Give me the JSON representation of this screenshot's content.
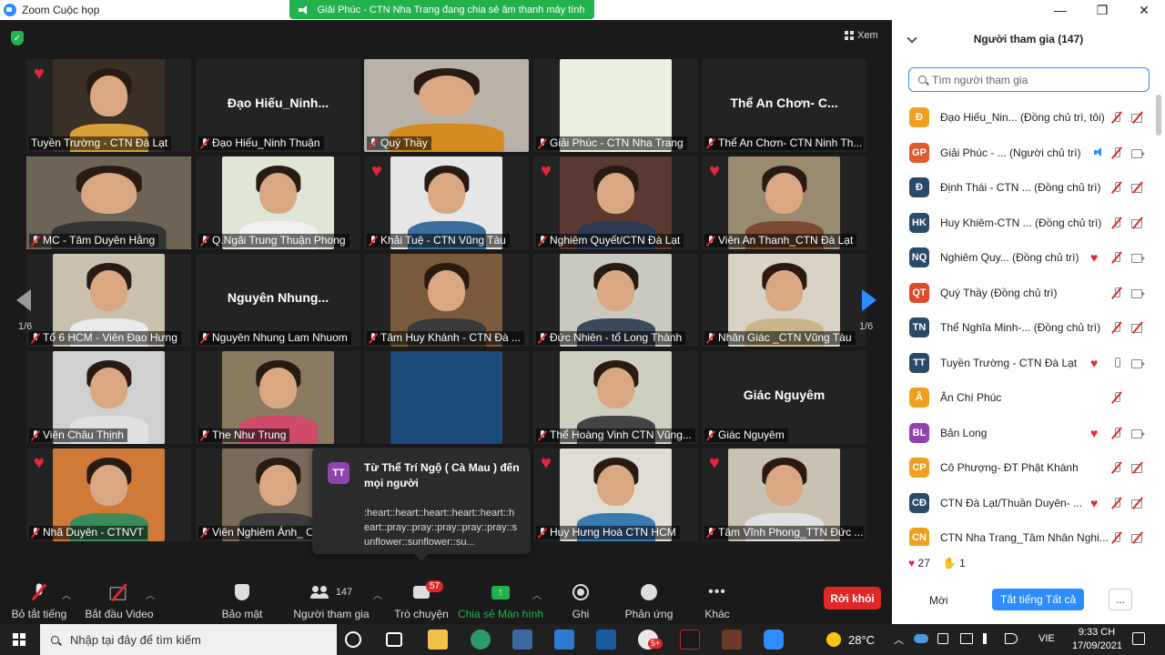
{
  "window": {
    "title": "Zoom Cuộc họp",
    "share_banner": "Giải Phúc - CTN Nha Trang đang chia sẻ âm thanh máy tính",
    "controls": [
      "—",
      "❐",
      "✕"
    ]
  },
  "meeting": {
    "view_label": "Xem",
    "page_left": "1/6",
    "page_right": "1/6",
    "tiles": [
      {
        "label": "Tuyền Trường - CTN Đà Lạt",
        "heart": true,
        "muted": false,
        "video": true,
        "bg": "#3b3025",
        "shirt": "#d9a03a"
      },
      {
        "label": "Đạo Hiếu_Ninh Thuận",
        "bigname": "Đạo  Hiếu_Ninh...",
        "heart": false,
        "muted": true,
        "video": false
      },
      {
        "label": "Quý Thầy",
        "heart": false,
        "muted": true,
        "video": true,
        "bg": "#b8b2a8",
        "shirt": "#d48a1e"
      },
      {
        "label": "Giải Phúc - CTN Nha Trang",
        "heart": false,
        "muted": true,
        "video": true,
        "bg": "#e9f2e2",
        "shirt": "#3f8f2f",
        "noface": true
      },
      {
        "label": "Thể An Chơn- CTN Ninh Th...",
        "bigname": "Thể An Chơn- C...",
        "heart": false,
        "muted": true,
        "video": false
      },
      {
        "label": "MC - Tâm Duyên Hằng",
        "heart": false,
        "muted": true,
        "video": true,
        "active": true,
        "bg": "#6e6455",
        "shirt": "#333"
      },
      {
        "label": "Q.Ngãi Trung Thuận Phong",
        "heart": false,
        "muted": true,
        "video": true,
        "bg": "#dfe6d6",
        "shirt": "#f0f0f0"
      },
      {
        "label": "Khải Tuệ - CTN Vũng Tàu",
        "heart": true,
        "muted": true,
        "video": true,
        "bg": "#e6e6e6",
        "shirt": "#3a6e9c"
      },
      {
        "label": "Nghiêm Quyết/CTN Đà Lạt",
        "heart": true,
        "muted": true,
        "video": true,
        "bg": "#5a3a30",
        "shirt": "#2c3a55"
      },
      {
        "label": "Viên An Thanh_CTN Đà Lạt",
        "heart": true,
        "muted": true,
        "video": true,
        "bg": "#9a8a70",
        "shirt": "#7a4a30"
      },
      {
        "label": "Tổ 6 HCM - Viên Đạo Hưng",
        "heart": false,
        "muted": true,
        "video": true,
        "bg": "#c9c0ad",
        "shirt": "#eaeaea"
      },
      {
        "label": "Nguyên Nhung Lam Nhuom",
        "bigname": "Nguyên  Nhung...",
        "heart": false,
        "muted": true,
        "video": false
      },
      {
        "label": "Tâm Huy Khánh - CTN Đà ...",
        "heart": false,
        "muted": true,
        "video": true,
        "bg": "#7a5a3a",
        "shirt": "#3a3a3a"
      },
      {
        "label": "Đức Nhiên - tổ Long Thành",
        "heart": false,
        "muted": true,
        "video": true,
        "bg": "#c9c9c2",
        "shirt": "#3a4a5a"
      },
      {
        "label": "Nhân Giác _CTN Vũng Tàu",
        "heart": false,
        "muted": true,
        "video": true,
        "bg": "#d9d2c5",
        "shirt": "#c9b58a"
      },
      {
        "label": "Viên Châu Thịnh",
        "heart": false,
        "muted": true,
        "video": true,
        "bg": "#d0d0d0",
        "shirt": "#e0e0e0"
      },
      {
        "label": "The Như Trung",
        "heart": false,
        "muted": true,
        "video": true,
        "bg": "#8a7a60",
        "shirt": "#d04a6a"
      },
      {
        "label": "",
        "heart": false,
        "muted": false,
        "video": true,
        "bg": "#1c4a7a",
        "shirt": "#6ab0e0",
        "noface": true
      },
      {
        "label": "Thể Hoàng Vinh CTN Vũng...",
        "heart": false,
        "muted": true,
        "video": true,
        "bg": "#cfcfc0",
        "shirt": "#444"
      },
      {
        "label": "Giác Nguyêm",
        "bigname": "Giác Nguyêm",
        "heart": false,
        "muted": true,
        "video": false
      },
      {
        "label": "Nhã Duyên - CTNVT",
        "heart": true,
        "muted": true,
        "video": true,
        "bg": "#d07a3a",
        "shirt": "#3a8a5a"
      },
      {
        "label": "Viên Nghiêm Ánh_ C",
        "heart": false,
        "muted": true,
        "video": true,
        "bg": "#7a6a5a",
        "shirt": "#3a3a3a"
      },
      {
        "label": "",
        "heart": false,
        "muted": false,
        "video": true,
        "bg": "#3a3a3a",
        "shirt": "#555",
        "noface": true
      },
      {
        "label": "Huy Hưng Hoà CTN HCM",
        "heart": true,
        "muted": true,
        "video": true,
        "bg": "#e0ddd5",
        "shirt": "#3a7ab0"
      },
      {
        "label": "Tâm Vĩnh Phong_TTN Đức ...",
        "heart": true,
        "muted": true,
        "video": true,
        "bg": "#c9c2b0",
        "shirt": "#e0e0e0"
      }
    ]
  },
  "chat_popup": {
    "avatar": "TT",
    "from": "Từ Thể Trí Ngộ ( Cà Mau ) đến mọi người",
    "message": ":heart::heart::heart::heart::heart::heart::pray::pray::pray::pray::pray::sunflower::sunflower::su..."
  },
  "toolbar": {
    "mute_all_label": "Bỏ tắt tiếng",
    "start_video_label": "Bắt đầu Video",
    "security_label": "Bảo mật",
    "participants_label": "Người tham gia",
    "participants_count": "147",
    "chat_label": "Trò chuyện",
    "chat_badge": "57",
    "share_label": "Chia sẻ Màn hình",
    "record_label": "Ghi",
    "reactions_label": "Phản ứng",
    "more_label": "Khác",
    "leave_label": "Rời khỏi"
  },
  "panel": {
    "title": "Người tham gia (147)",
    "search_placeholder": "Tìm người tham gia",
    "participants": [
      {
        "initials": "Đ",
        "color": "#f0a020",
        "name": "Đạo Hiếu_Nin... (Đồng chủ trì, tôi)",
        "heart": false,
        "mic": "off",
        "cam": "off"
      },
      {
        "initials": "GP",
        "color": "#e05a2a",
        "name": "Giải Phúc - ...   (Người chủ trì)",
        "heart": false,
        "mic": "speaking",
        "cam": "on"
      },
      {
        "initials": "Đ",
        "color": "#2a4a6a",
        "name": "Định Thái - CTN ...   (Đồng chủ trì)",
        "heart": false,
        "mic": "off",
        "cam": "off"
      },
      {
        "initials": "HK",
        "color": "#2a4a6a",
        "name": "Huy Khiêm-CTN ...   (Đồng chủ trì)",
        "heart": false,
        "mic": "off",
        "cam": "off"
      },
      {
        "initials": "NQ",
        "color": "#2a4a6a",
        "name": "Nghiêm Quy...   (Đồng chủ trì)",
        "heart": true,
        "mic": "off",
        "cam": "on"
      },
      {
        "initials": "QT",
        "color": "#e04a2a",
        "name": "Quý Thầy (Đồng chủ trì)",
        "heart": false,
        "mic": "off",
        "cam": "on"
      },
      {
        "initials": "TN",
        "color": "#2a4a6a",
        "name": "Thể Nghĩa Minh-...   (Đồng chủ trì)",
        "heart": false,
        "mic": "off",
        "cam": "off"
      },
      {
        "initials": "TT",
        "color": "#2a4a6a",
        "name": "Tuyền Trường - CTN Đà Lạt",
        "heart": true,
        "mic": "on",
        "cam": "on"
      },
      {
        "initials": "Â",
        "color": "#f0a020",
        "name": "Ân Chí Phúc",
        "heart": false,
        "mic": "off",
        "cam": "none"
      },
      {
        "initials": "BL",
        "color": "#8e44ad",
        "name": "Bản Long",
        "heart": true,
        "mic": "off",
        "cam": "on"
      },
      {
        "initials": "CP",
        "color": "#f0a020",
        "name": "Cô Phượng- ĐT Phật Khánh",
        "heart": false,
        "mic": "off",
        "cam": "off"
      },
      {
        "initials": "CĐ",
        "color": "#2a4a6a",
        "name": "CTN Đà Lạt/Thuần Duyên- ...",
        "heart": true,
        "mic": "off",
        "cam": "off"
      },
      {
        "initials": "CN",
        "color": "#f0a020",
        "name": "CTN Nha Trang_Tâm Nhân Nghi...",
        "heart": false,
        "mic": "off",
        "cam": "off"
      }
    ],
    "reactions": {
      "heart_count": "27",
      "clap_count": "1"
    },
    "invite_label": "Mời",
    "mute_all_label": "Tắt tiếng Tất cả",
    "more_label": "..."
  },
  "taskbar": {
    "search_placeholder": "Nhập tại đây để tìm kiếm",
    "weather": "28°C",
    "language": "VIE",
    "time": "9:33 CH",
    "date": "17/09/2021",
    "app_badge": "5+"
  }
}
